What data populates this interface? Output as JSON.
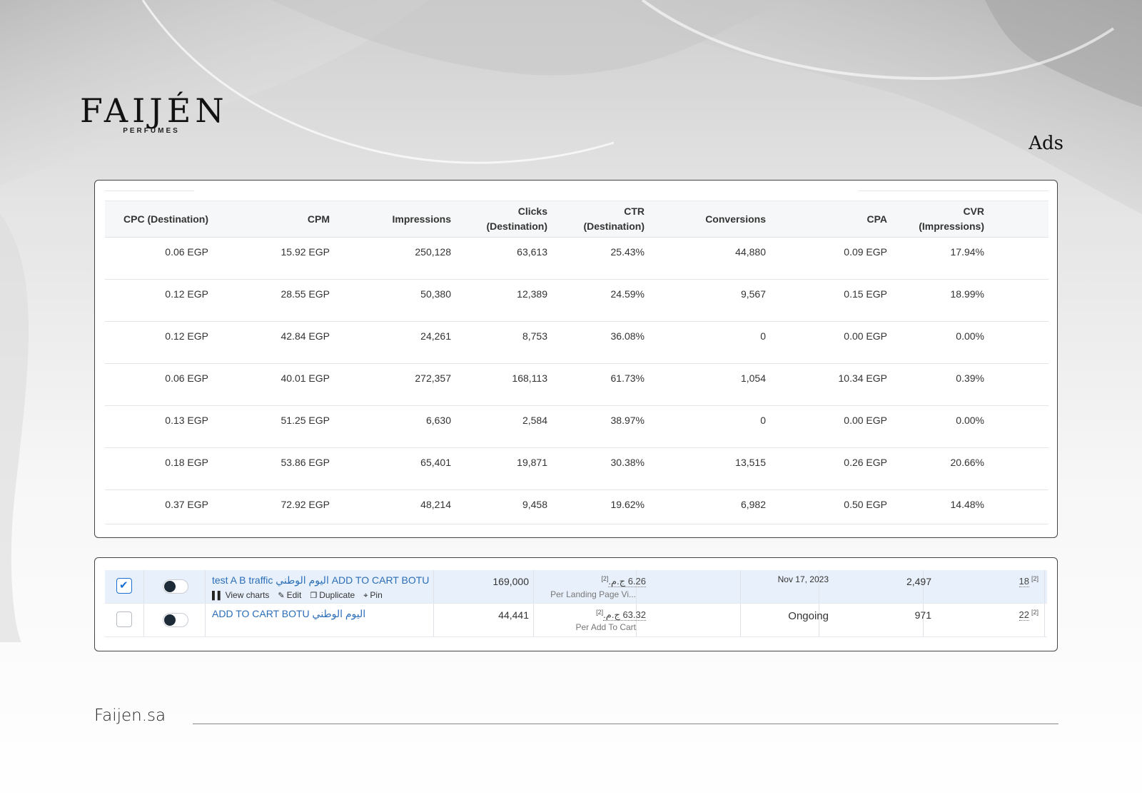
{
  "brand": {
    "name": "FAIJÉN",
    "tagline": "PERFUMES",
    "website": "Faijen.sa"
  },
  "page": {
    "title": "Ads"
  },
  "metrics_table": {
    "columns": [
      [
        "CPC (Destination)"
      ],
      [
        "CPM"
      ],
      [
        "Impressions"
      ],
      [
        "Clicks",
        "(Destination)"
      ],
      [
        "CTR",
        "(Destination)"
      ],
      [
        "Conversions"
      ],
      [
        "CPA"
      ],
      [
        "CVR",
        "(Impressions)"
      ]
    ],
    "rows": [
      [
        "0.06 EGP",
        "15.92 EGP",
        "250,128",
        "63,613",
        "25.43%",
        "44,880",
        "0.09 EGP",
        "17.94%"
      ],
      [
        "0.12 EGP",
        "28.55 EGP",
        "50,380",
        "12,389",
        "24.59%",
        "9,567",
        "0.15 EGP",
        "18.99%"
      ],
      [
        "0.12 EGP",
        "42.84 EGP",
        "24,261",
        "8,753",
        "36.08%",
        "0",
        "0.00 EGP",
        "0.00%"
      ],
      [
        "0.06 EGP",
        "40.01 EGP",
        "272,357",
        "168,113",
        "61.73%",
        "1,054",
        "10.34 EGP",
        "0.39%"
      ],
      [
        "0.13 EGP",
        "51.25 EGP",
        "6,630",
        "2,584",
        "38.97%",
        "0",
        "0.00 EGP",
        "0.00%"
      ],
      [
        "0.18 EGP",
        "53.86 EGP",
        "65,401",
        "19,871",
        "30.38%",
        "13,515",
        "0.26 EGP",
        "20.66%"
      ],
      [
        "0.37 EGP",
        "72.92 EGP",
        "48,214",
        "9,458",
        "19.62%",
        "6,982",
        "0.50 EGP",
        "14.48%"
      ]
    ]
  },
  "ads_table": {
    "rows": [
      {
        "selected": true,
        "toggle_on": true,
        "name": "test A B traffic اليوم الوطني ADD TO CART BOTU",
        "actions": [
          {
            "label": "View charts",
            "icon": "bar-chart-icon"
          },
          {
            "label": "Edit",
            "icon": "pencil-icon"
          },
          {
            "label": "Duplicate",
            "icon": "copy-icon"
          },
          {
            "label": "Pin",
            "icon": "pin-icon"
          }
        ],
        "reach": "169,000",
        "cost": "‏6.26 ج.م.",
        "cost_note": "[2]",
        "cost_caption": "Per Landing Page Vi...",
        "status": "Nov 17, 2023",
        "results": "2,497",
        "last": "18",
        "last_note": "[2]"
      },
      {
        "selected": false,
        "toggle_on": true,
        "name": "ADD TO CART BOTU اليوم الوطني",
        "actions": [],
        "reach": "44,441",
        "cost": "‏63.32 ج.م.",
        "cost_note": "[2]",
        "cost_caption": "Per Add To Cart",
        "status": "Ongoing",
        "results": "971",
        "last": "22",
        "last_note": "[2]"
      }
    ]
  }
}
